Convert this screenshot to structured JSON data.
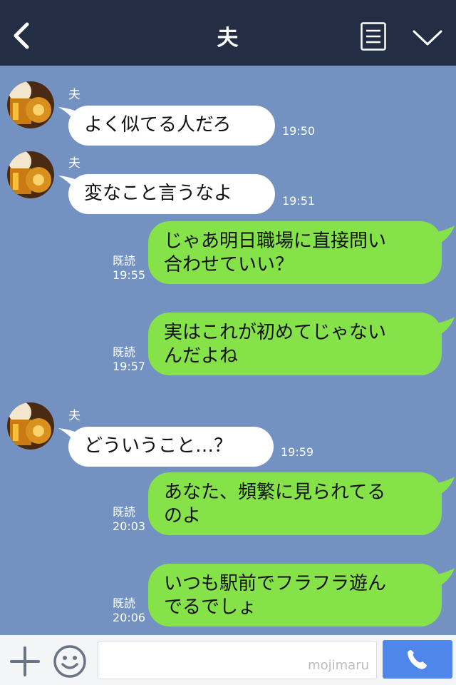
{
  "header": {
    "title": "夫"
  },
  "messages": [
    {
      "sender": "夫",
      "text": "よく似てる人だろ",
      "time": "19:50"
    },
    {
      "sender": "夫",
      "text": "変なこと言うなよ",
      "time": "19:51"
    },
    {
      "read": "既読",
      "line1": "じゃあ明日職場に直接問い",
      "line2": "合わせていい？",
      "time": "19:55"
    },
    {
      "read": "既読",
      "line1": "実はこれが初めてじゃない",
      "line2": "んだよね",
      "time": "19:57"
    },
    {
      "sender": "夫",
      "text": "どういうこと…？",
      "time": "19:59"
    },
    {
      "read": "既読",
      "line1": "あなた、頻繁に見られてる",
      "line2": "のよ",
      "time": "20:03"
    },
    {
      "read": "既読",
      "line1": "いつも駅前でフラフラ遊ん",
      "line2": "でるでしょ",
      "time": "20:06"
    }
  ],
  "footer": {
    "watermark": "mojimaru"
  },
  "colors": {
    "header_bg": "#232e44",
    "chat_bg": "#7391c1",
    "outgoing_bubble": "#85e249",
    "incoming_bubble": "#ffffff",
    "send_button": "#4e86e9"
  },
  "icons": [
    "back-icon",
    "menu-icon",
    "chevron-down-icon",
    "plus-icon",
    "smile-icon",
    "phone-icon"
  ]
}
